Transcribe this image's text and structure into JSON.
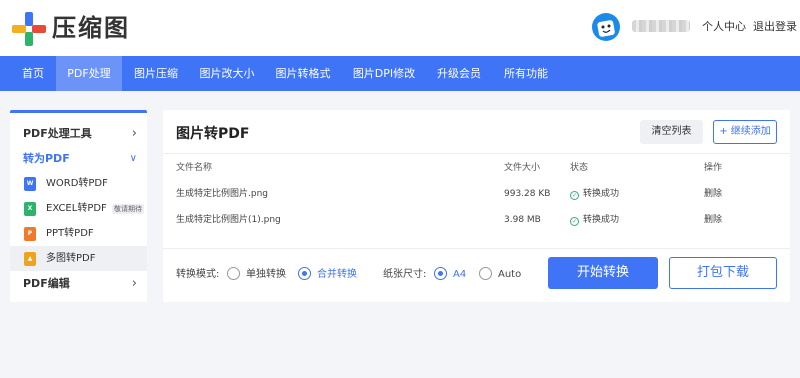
{
  "header": {
    "logo_text": "压缩图",
    "user_center": "个人中心",
    "logout": "退出登录"
  },
  "nav": {
    "items": [
      "首页",
      "PDF处理",
      "图片压缩",
      "图片改大小",
      "图片转格式",
      "图片DPI修改",
      "升级会员",
      "所有功能"
    ],
    "active_index": 1
  },
  "sidebar": {
    "group1": "PDF处理工具",
    "group2": "转为PDF",
    "items": [
      {
        "label": "WORD转PDF",
        "icon": "word-icon"
      },
      {
        "label": "EXCEL转PDF",
        "icon": "excel-icon",
        "badge": "敬请期待"
      },
      {
        "label": "PPT转PDF",
        "icon": "ppt-icon"
      },
      {
        "label": "多图转PDF",
        "icon": "image-pdf-icon"
      }
    ],
    "group3": "PDF编辑"
  },
  "main": {
    "title": "图片转PDF",
    "clear_label": "清空列表",
    "add_label": "+ 继续添加",
    "columns": [
      "文件名称",
      "文件大小",
      "状态",
      "操作"
    ],
    "rows": [
      {
        "name": "生成特定比例图片.png",
        "size": "993.28 KB",
        "status": "转换成功",
        "action": "删除"
      },
      {
        "name": "生成特定比例图片(1).png",
        "size": "3.98 MB",
        "status": "转换成功",
        "action": "删除"
      }
    ],
    "mode_label": "转换模式:",
    "mode_options": [
      "单独转换",
      "合并转换"
    ],
    "mode_selected": "合并转换",
    "paper_label": "纸张尺寸:",
    "paper_options": [
      "A4",
      "Auto"
    ],
    "paper_selected": "A4",
    "start_label": "开始转换",
    "pack_label": "打包下载"
  },
  "colors": {
    "accent": "#3f74f6",
    "success": "#2db46b"
  }
}
